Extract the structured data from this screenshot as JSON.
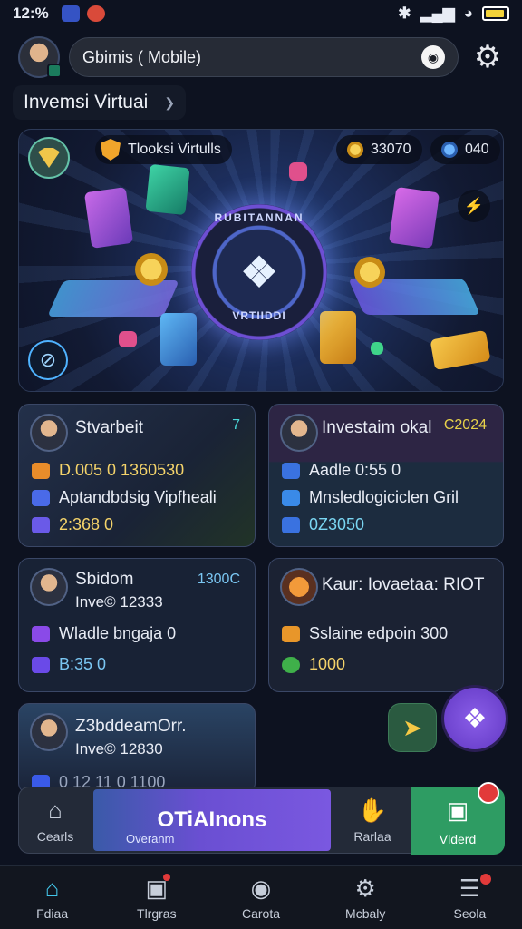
{
  "status": {
    "time": "12:%"
  },
  "header": {
    "app_title": "Gbimis ( Mobile)"
  },
  "section": {
    "title": "Invemsi Virtuai"
  },
  "hero": {
    "chip_label": "Tlooksi Virtulls",
    "stat_coins": "33070",
    "stat_gems": "040",
    "emblem_top": "RUBITANNAN",
    "emblem_bottom": "VRTIIDDI"
  },
  "cards": [
    {
      "name": "Stvarbeit",
      "tag": "7",
      "rows": [
        "D.005 0 1360530",
        "Aptandbdsig Vipfheali",
        "2:368 0"
      ]
    },
    {
      "name": "Investaim okal",
      "tag": "C2024",
      "rows": [
        "Aadle 0:55 0",
        "Mnsledlogiciclen Gril",
        "0Z3050"
      ]
    },
    {
      "name": "Sbidom",
      "tag": "1300C",
      "sub": "Inve© 12333",
      "rows": [
        "Wladle bngaja 0",
        "B:35 0"
      ]
    },
    {
      "name": "Kaur: Iovaetaa: RIOT",
      "rows": [
        "Sslaine edpoin 300",
        "1000"
      ]
    },
    {
      "name": "Z3bddeamOrr.",
      "sub": "Inve© 12830",
      "rows": [
        "0 12 11 0 1100"
      ]
    }
  ],
  "toolbar": {
    "left_label": "Cearls",
    "center_label": "OTiAInons",
    "center_sub": "Overanm",
    "right_label": "Rarlaa",
    "green_label": "Vlderd"
  },
  "nav": [
    {
      "label": "Fdiaa",
      "icon": "home-icon"
    },
    {
      "label": "Tlrgras",
      "icon": "gift-icon"
    },
    {
      "label": "Carota",
      "icon": "key-icon"
    },
    {
      "label": "Mcbaly",
      "icon": "gear-icon"
    },
    {
      "label": "Seola",
      "icon": "menu-icon"
    }
  ]
}
